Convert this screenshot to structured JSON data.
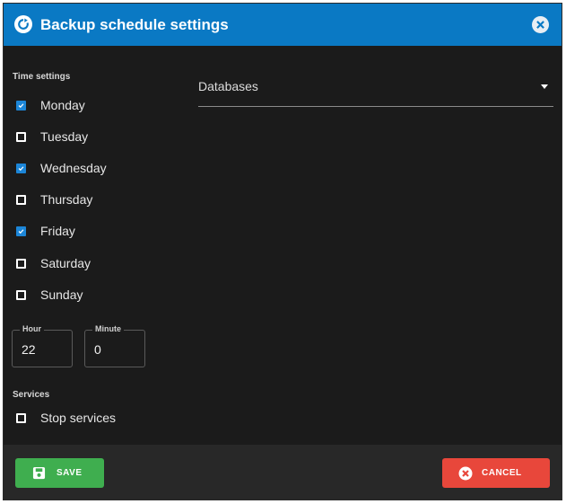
{
  "dialog": {
    "title": "Backup schedule settings",
    "title_icon": "refresh-icon",
    "close_icon": "close-circle-icon"
  },
  "time_settings": {
    "label": "Time settings",
    "days": [
      {
        "label": "Monday",
        "checked": true
      },
      {
        "label": "Tuesday",
        "checked": false
      },
      {
        "label": "Wednesday",
        "checked": true
      },
      {
        "label": "Thursday",
        "checked": false
      },
      {
        "label": "Friday",
        "checked": true
      },
      {
        "label": "Saturday",
        "checked": false
      },
      {
        "label": "Sunday",
        "checked": false
      }
    ],
    "hour": {
      "label": "Hour",
      "value": "22"
    },
    "minute": {
      "label": "Minute",
      "value": "0"
    }
  },
  "services": {
    "label": "Services",
    "stop_services": {
      "label": "Stop services",
      "checked": false
    }
  },
  "databases": {
    "label": "Databases"
  },
  "footer": {
    "save_label": "SAVE",
    "cancel_label": "CANCEL"
  },
  "colors": {
    "titlebar": "#0a79c4",
    "checked": "#1c86d8",
    "save": "#3fae4f",
    "cancel": "#e8473b"
  }
}
